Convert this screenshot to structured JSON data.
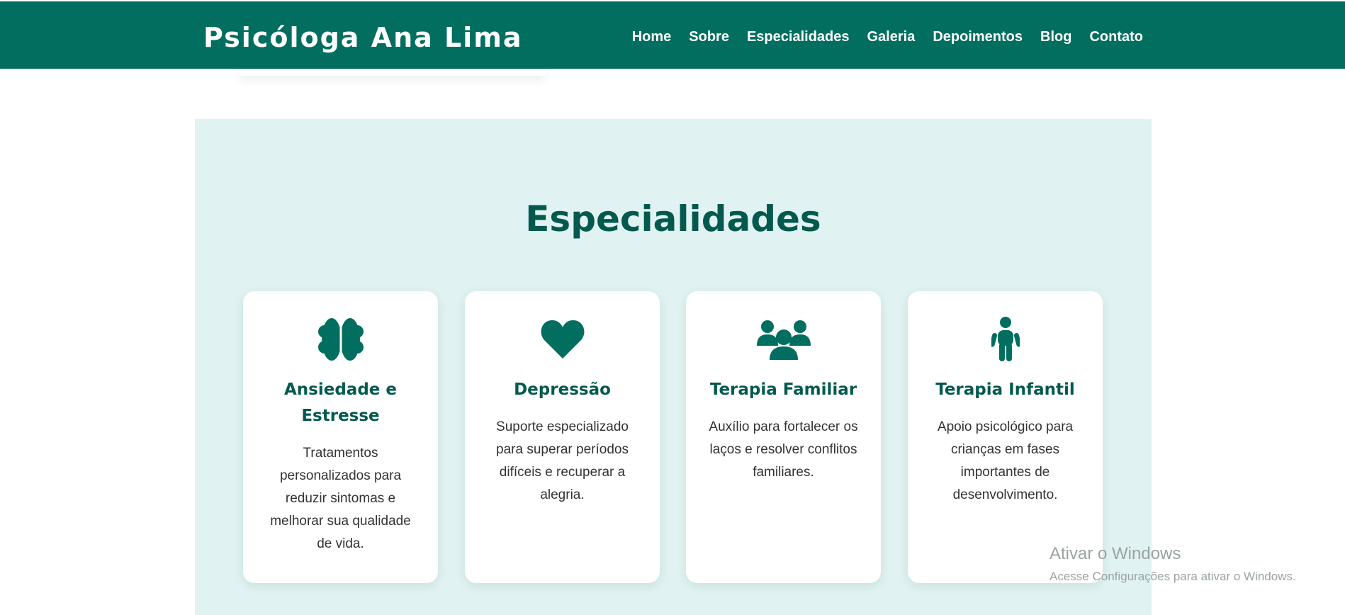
{
  "header": {
    "brand": "Psicóloga Ana Lima",
    "nav": [
      "Home",
      "Sobre",
      "Especialidades",
      "Galeria",
      "Depoimentos",
      "Blog",
      "Contato"
    ]
  },
  "specialties": {
    "title": "Especialidades",
    "cards": [
      {
        "icon": "brain-icon",
        "title": "Ansiedade e Estresse",
        "text": "Tratamentos personalizados para reduzir sintomas e melhorar sua qualidade de vida."
      },
      {
        "icon": "heart-icon",
        "title": "Depressão",
        "text": "Suporte especializado para superar períodos difíceis e recuperar a alegria."
      },
      {
        "icon": "family-icon",
        "title": "Terapia Familiar",
        "text": "Auxílio para fortalecer os laços e resolver conflitos familiares."
      },
      {
        "icon": "child-icon",
        "title": "Terapia Infantil",
        "text": "Apoio psicológico para crianças em fases importantes de desenvolvimento."
      }
    ]
  },
  "watermark": {
    "title": "Ativar o Windows",
    "subtitle": "Acesse Configurações para ativar o Windows."
  },
  "colors": {
    "primary": "#016e5f",
    "heading": "#03594d",
    "section_bg": "#e0f2f1"
  }
}
